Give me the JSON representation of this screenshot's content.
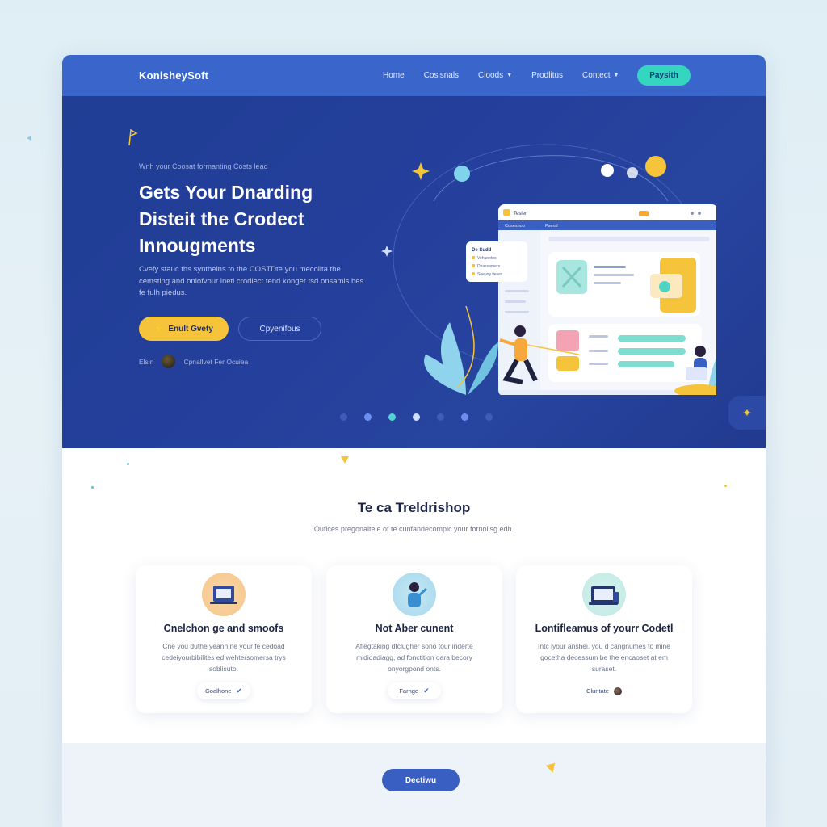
{
  "nav": {
    "brand": "KonisheySoft",
    "items": [
      {
        "label": "Home",
        "has_dropdown": false
      },
      {
        "label": "Cosisnals",
        "has_dropdown": false
      },
      {
        "label": "Cloods",
        "has_dropdown": true
      },
      {
        "label": "Prodlitus",
        "has_dropdown": false
      },
      {
        "label": "Contect",
        "has_dropdown": true
      }
    ],
    "cta": "Paysith"
  },
  "hero": {
    "eyebrow": "Wnh your Coosat formanting Costs lead",
    "title_lines": [
      "Gets Your Dnarding",
      "Disteit the Crodect",
      "Innougments"
    ],
    "lead": "Cvefy stauc ths synthelns to the COSTDte you mecolita the cemsting and onlofvour inetl crodiect tend konger tsd onsamis hes fe fulh piedus.",
    "primary_button": "Enult Gvety",
    "secondary_button": "Cpyenifous",
    "trust_label": "Elsin",
    "trust_text": "Cpnallvet Fer Ocuiea",
    "carousel_count": 7,
    "carousel_active": 4
  },
  "mockup": {
    "window_title": "Tesler",
    "tabs": [
      "Cosesnou",
      "Pseral"
    ],
    "popup_title": "De Sudd",
    "popup_items": [
      "Vehunetes",
      "Dnassamers",
      "Seeuoy iteres"
    ]
  },
  "features": {
    "title": "Te ca Treldrishop",
    "subtitle": "Oufices pregonaitele of te cunfandecompic your fornolisg edh.",
    "cards": [
      {
        "title": "Cnelchon ge and smoofs",
        "text": "Cne you duthe yeanh ne your fe cedoad cedeiyourbibilites ed wehtersomersa trys soblisuto.",
        "tag": "Goalhone",
        "icon": "laptop-icon",
        "accent": "#f6c48a"
      },
      {
        "title": "Not Aber cunent",
        "text": "Aflegtaking dtclugher sono tour inderte mididadiagg, ad fonctition oara becory onyorgpond onts.",
        "tag": "Farnge",
        "icon": "person-icon",
        "accent": "#a7d8ec"
      },
      {
        "title": "Lontifleamus of yourr Codetl",
        "text": "Intc iyour anshei, you d cangnumes to mine gocetha decessum be the encaoset at em suraset.",
        "tag": "Cluntate",
        "icon": "computer-icon",
        "accent": "#bfe9e3"
      }
    ]
  },
  "footer": {
    "button": "Dectiwu"
  },
  "colors": {
    "nav": "#3a66cc",
    "hero": "#243f9b",
    "accent_yellow": "#f6c43a",
    "accent_teal": "#35d6c0"
  }
}
